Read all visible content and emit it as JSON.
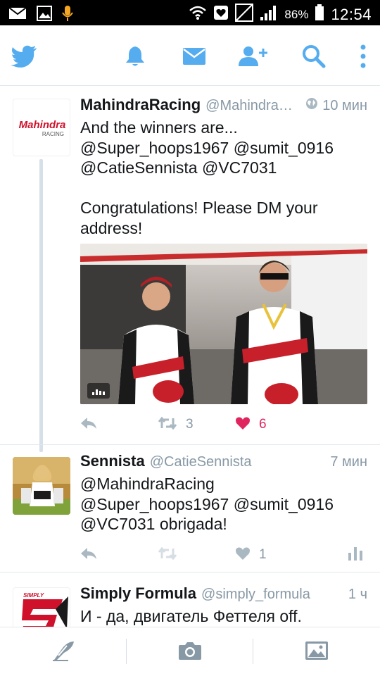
{
  "status_bar": {
    "battery_percent": "86%",
    "time": "12:54"
  },
  "app_bar": {
    "icons": [
      "twitter-bird-icon",
      "notifications-bell-icon",
      "messages-envelope-icon",
      "add-user-icon",
      "search-icon",
      "overflow-menu-icon"
    ],
    "accent": "#55acee"
  },
  "colors": {
    "accent": "#55acee",
    "muted": "#8899a6",
    "like": "#e0245e"
  },
  "tweets": [
    {
      "name": "MahindraRacing",
      "handle": "@Mahindra…",
      "time": "10 мин",
      "avatar_text": "Mahindra",
      "avatar_subtext": "RACING",
      "text": "And the winners are...\n@Super_hoops1967 @sumit_0916\n@CatieSennista @VC7031\n\nCongratulations! Please DM your\naddress!",
      "retweets": "3",
      "likes": "6"
    },
    {
      "name": "Sennista",
      "handle": "@CatieSennista",
      "time": "7 мин",
      "text": "@MahindraRacing\n@Super_hoops1967 @sumit_0916\n@VC7031 obrigada!",
      "likes": "1"
    },
    {
      "name": "Simply Formula",
      "handle": "@simply_formula",
      "time": "1 ч",
      "avatar_text": "SIMPLY",
      "text": "И - да, двигатель Феттеля off."
    }
  ],
  "bottom_bar": {
    "icons": [
      "compose-tweet-icon",
      "camera-icon",
      "gallery-icon"
    ]
  }
}
